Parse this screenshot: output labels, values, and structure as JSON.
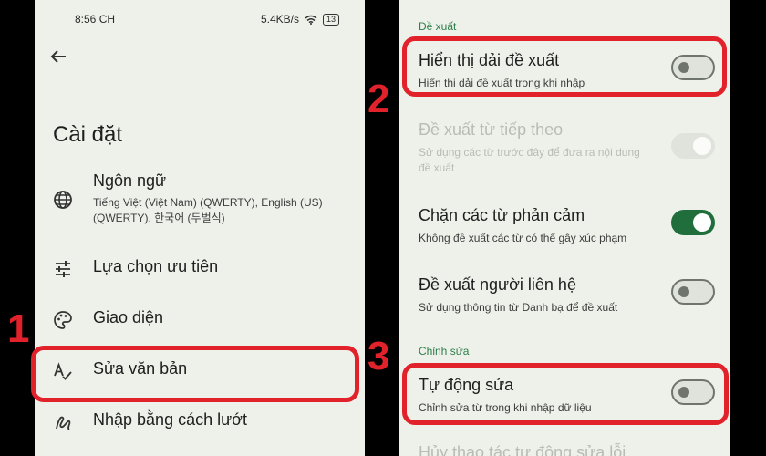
{
  "left": {
    "status": {
      "time": "8:56 CH",
      "network": "5.4KB/s",
      "battery": "13"
    },
    "title": "Cài đặt",
    "items": [
      {
        "label": "Ngôn ngữ",
        "subtitle": "Tiếng Việt (Việt Nam) (QWERTY), English (US) (QWERTY), 한국어 (두벌식)",
        "icon": "globe-icon"
      },
      {
        "label": "Lựa chọn ưu tiên",
        "icon": "sliders-icon"
      },
      {
        "label": "Giao diện",
        "icon": "palette-icon"
      },
      {
        "label": "Sửa văn bản",
        "icon": "text-check-icon"
      },
      {
        "label": "Nhập bằng cách lướt",
        "icon": "swipe-icon"
      }
    ]
  },
  "right": {
    "section_suggestions": "Đề xuất",
    "section_correction": "Chỉnh sửa",
    "settings": [
      {
        "title": "Hiển thị dải đề xuất",
        "desc": "Hiển thị dải đề xuất trong khi nhập",
        "state": "off"
      },
      {
        "title": "Đề xuất từ tiếp theo",
        "desc": "Sử dụng các từ trước đây để đưa ra nội dung đề xuất",
        "state": "disabled"
      },
      {
        "title": "Chặn các từ phản cảm",
        "desc": "Không đề xuất các từ có thể gây xúc phạm",
        "state": "on"
      },
      {
        "title": "Đề xuất người liên hệ",
        "desc": "Sử dụng thông tin từ Danh bạ để đề xuất",
        "state": "off"
      },
      {
        "title": "Tự động sửa",
        "desc": "Chỉnh sửa từ trong khi nhập dữ liệu",
        "state": "off"
      },
      {
        "title": "Hủy thao tác tự động sửa lỗi"
      }
    ]
  },
  "steps": [
    "1",
    "2",
    "3"
  ],
  "colors": {
    "highlight": "#e1222b",
    "accent": "#1f6e3c",
    "panel_bg": "#eef1ea"
  }
}
